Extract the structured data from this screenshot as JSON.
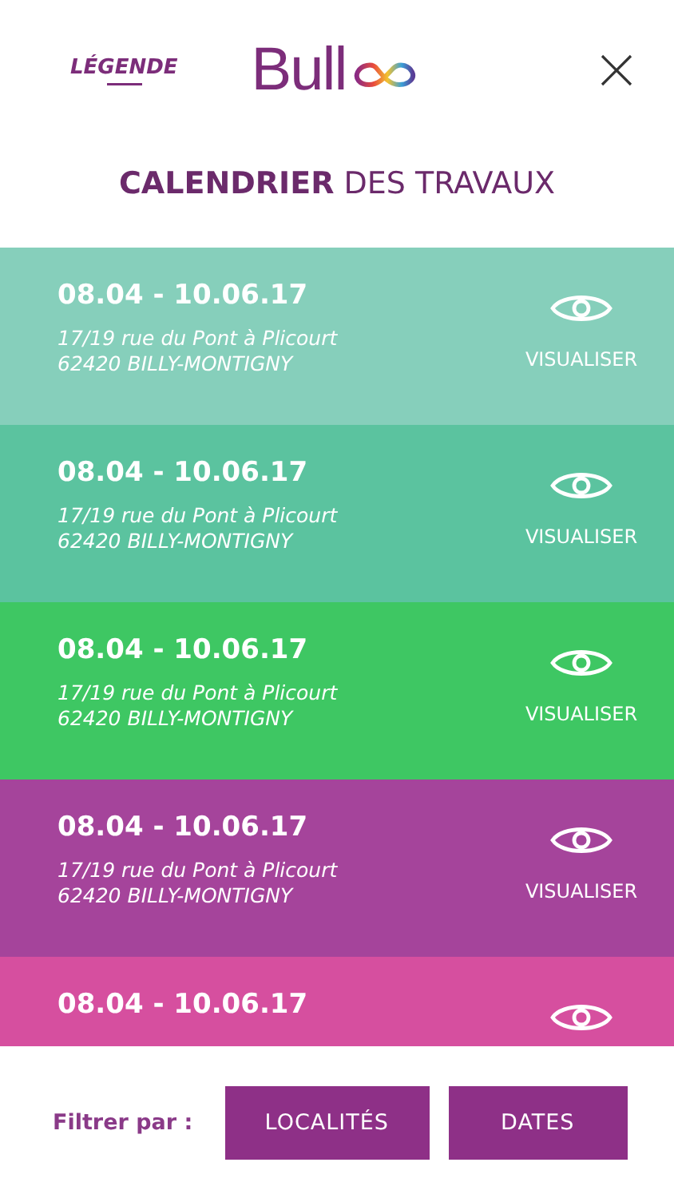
{
  "header": {
    "legend_link": "LÉGENDE",
    "logo_text": "Bull",
    "title": "**CALENDRIER** DES TRAVAUX"
  },
  "works": [
    {
      "dates": "08.04 - 10.06.17",
      "address": [
        "17/19 rue du Pont à Plicourt",
        "62420 BILLY-MONTIGNY"
      ],
      "action": "VISUALISER",
      "color": "#86cfbb"
    },
    {
      "dates": "08.04 - 10.06.17",
      "address": [
        "17/19 rue du Pont à Plicourt",
        "62420 BILLY-MONTIGNY"
      ],
      "action": "VISUALISER",
      "color": "#5bc39f"
    },
    {
      "dates": "08.04 - 10.06.17",
      "address": [
        "17/19 rue du Pont à Plicourt",
        "62420 BILLY-MONTIGNY"
      ],
      "action": "VISUALISER",
      "color": "#3ec763"
    },
    {
      "dates": "08.04 - 10.06.17",
      "address": [
        "17/19 rue du Pont à Plicourt",
        "62420 BILLY-MONTIGNY"
      ],
      "action": "VISUALISER",
      "color": "#a5449b"
    },
    {
      "dates": "08.04 - 10.06.17",
      "color": "#d64f9f"
    }
  ],
  "filter": {
    "label": "Filtrer par :",
    "buttons": [
      "LOCALITÉS",
      "DATES"
    ]
  }
}
